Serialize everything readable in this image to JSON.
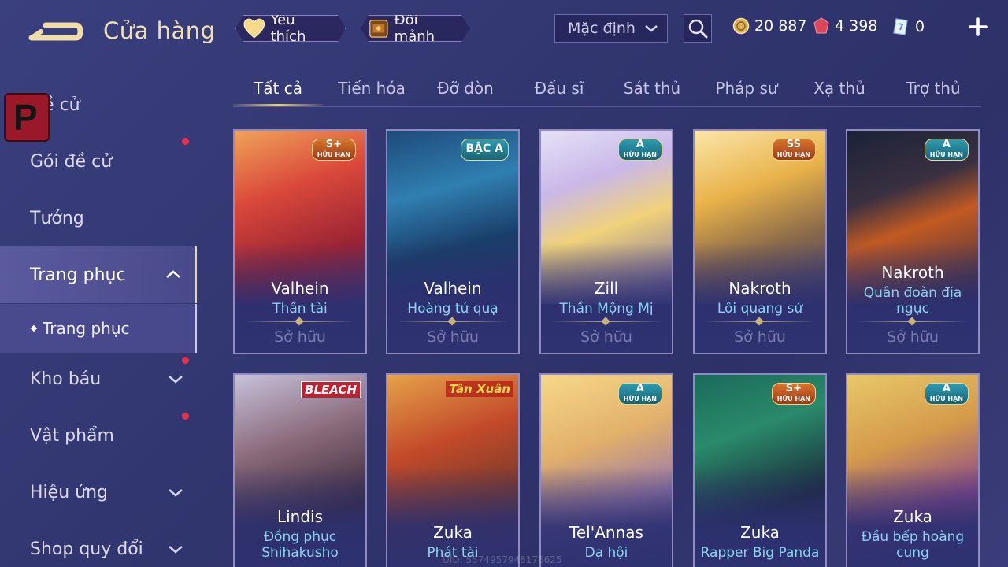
{
  "header": {
    "title": "Cửa hàng",
    "favorite_label": "Yêu thích",
    "exchange_label": "Đổi mảnh",
    "sort": {
      "selected": "Mặc định"
    },
    "currencies": [
      {
        "name": "gold",
        "icon": "gold-coin-icon",
        "value": "20 887"
      },
      {
        "name": "voucher",
        "icon": "red-gem-icon",
        "value": "4 398"
      },
      {
        "name": "fragment",
        "icon": "fragment-card-icon",
        "value": "0"
      }
    ]
  },
  "sidebar": {
    "items": [
      {
        "label": "Đề cử"
      },
      {
        "label": "Gói đề cử"
      },
      {
        "label": "Tướng"
      },
      {
        "label": "Trang phục"
      },
      {
        "label": "Kho báu"
      },
      {
        "label": "Vật phẩm"
      },
      {
        "label": "Hiệu ứng"
      },
      {
        "label": "Shop quy đổi"
      }
    ],
    "sub_item": "Trang phục"
  },
  "tabs": [
    {
      "label": "Tất cả"
    },
    {
      "label": "Tiến hóa"
    },
    {
      "label": "Đỡ đòn"
    },
    {
      "label": "Đấu sĩ"
    },
    {
      "label": "Sát thủ"
    },
    {
      "label": "Pháp sư"
    },
    {
      "label": "Xạ thủ"
    },
    {
      "label": "Trợ thủ"
    }
  ],
  "cards": [
    {
      "hero": "Valhein",
      "skin": "Thần tài",
      "badge_tier": "S+",
      "badge_limited": "HỮU HẠN",
      "status": "Sở hữu"
    },
    {
      "hero": "Valhein",
      "skin": "Hoàng tử quạ",
      "badge_tier": "BẬC A",
      "badge_limited": "",
      "status": "Sở hữu"
    },
    {
      "hero": "Zill",
      "skin": "Thần Mộng Mị",
      "badge_tier": "A",
      "badge_limited": "HỮU HẠN",
      "status": "Sở hữu"
    },
    {
      "hero": "Nakroth",
      "skin": "Lôi quang sứ",
      "badge_tier": "SS",
      "badge_limited": "HỮU HẠN",
      "status": "Sở hữu"
    },
    {
      "hero": "Nakroth",
      "skin": "Quân đoàn địa ngục",
      "badge_tier": "A",
      "badge_limited": "HỮU HẠN",
      "status": "Sở hữu"
    },
    {
      "hero": "Lindis",
      "skin": "Đồng phục Shihakusho",
      "collab": "BLEACH"
    },
    {
      "hero": "Zuka",
      "skin": "Phát tài",
      "collab": "Tân Xuân"
    },
    {
      "hero": "Tel'Annas",
      "skin": "Dạ hội",
      "badge_tier": "A",
      "badge_limited": "HỮU HẠN"
    },
    {
      "hero": "Zuka",
      "skin": "Rapper Big Panda",
      "badge_tier": "S+",
      "badge_limited": "HỮU HẠN"
    },
    {
      "hero": "Zuka",
      "skin": "Đầu bếp hoàng cung",
      "badge_tier": "A",
      "badge_limited": "HỮU HẠN"
    }
  ],
  "footer": {
    "uid": "UID: 5574957946176625"
  },
  "colors": {
    "accent_gold": "#e9cf82",
    "skin_name": "#8ad3f2",
    "notify_red": "#e8324a"
  }
}
